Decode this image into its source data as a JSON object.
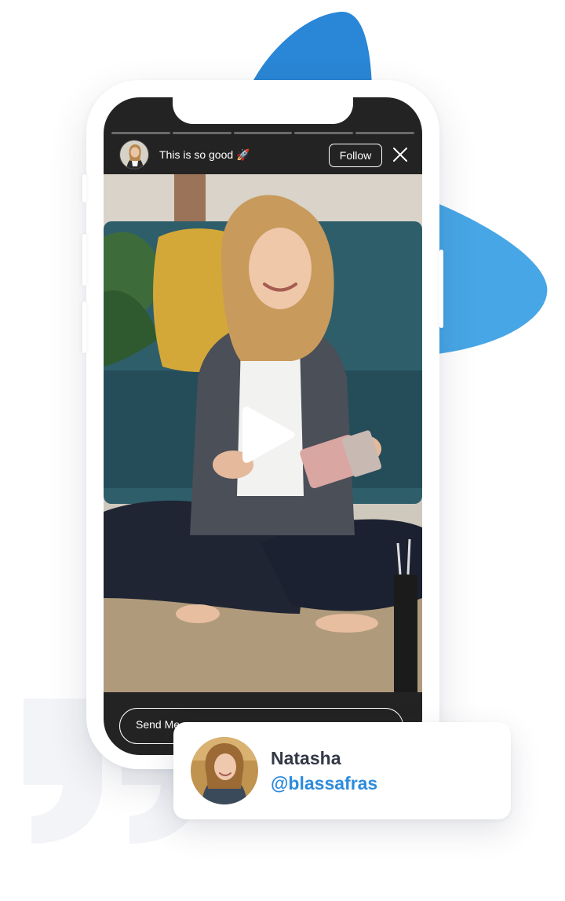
{
  "colors": {
    "accent_blue": "#2d8bdc",
    "blob_blue_dark": "#2a86d6",
    "blob_blue_light": "#47a6e6",
    "screen_bg": "#232323",
    "name_text": "#333846"
  },
  "story": {
    "progress_segments": 5,
    "title": "This is so good 🚀",
    "follow_label": "Follow",
    "close_icon": "close-icon",
    "play_icon": "play-icon",
    "message_placeholder": "Send Me"
  },
  "profile": {
    "name": "Natasha",
    "handle": "@blassafras"
  }
}
